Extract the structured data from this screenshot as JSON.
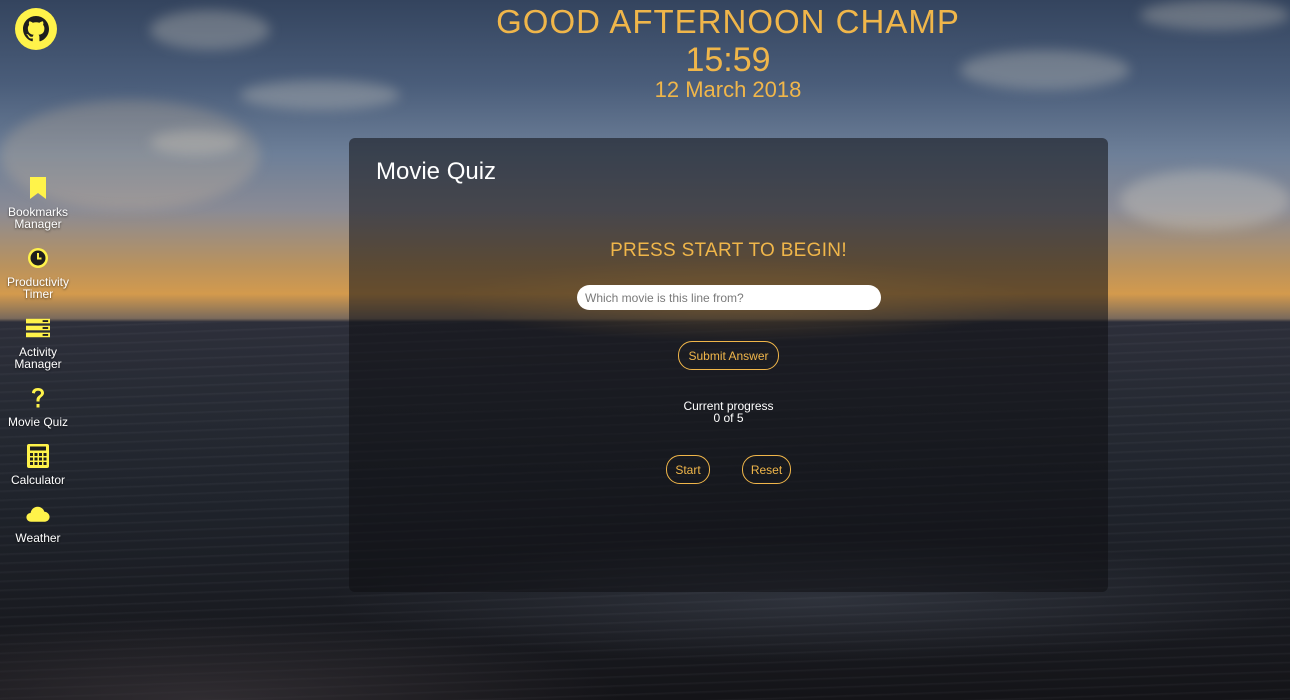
{
  "header": {
    "greeting": "GOOD AFTERNOON CHAMP",
    "time": "15:59",
    "date": "12 March 2018"
  },
  "github": {
    "icon": "github-icon"
  },
  "sidebar": {
    "items": [
      {
        "label": "Bookmarks\nManager",
        "icon": "bookmark-icon"
      },
      {
        "label": "Productivity\nTimer",
        "icon": "clock-icon"
      },
      {
        "label": "Activity\nManager",
        "icon": "list-icon"
      },
      {
        "label": "Movie Quiz",
        "icon": "question-icon"
      },
      {
        "label": "Calculator",
        "icon": "calculator-icon"
      },
      {
        "label": "Weather",
        "icon": "cloud-icon"
      }
    ]
  },
  "quiz": {
    "title": "Movie Quiz",
    "prompt": "PRESS START TO BEGIN!",
    "input_placeholder": "Which movie is this line from?",
    "input_value": "",
    "submit_label": "Submit Answer",
    "progress_label": "Current progress",
    "progress_value": "0 of 5",
    "start_label": "Start",
    "reset_label": "Reset"
  },
  "colors": {
    "accent": "#f0b64a",
    "icon_yellow": "#fff34a",
    "panel_bg": "#0f0f12"
  }
}
